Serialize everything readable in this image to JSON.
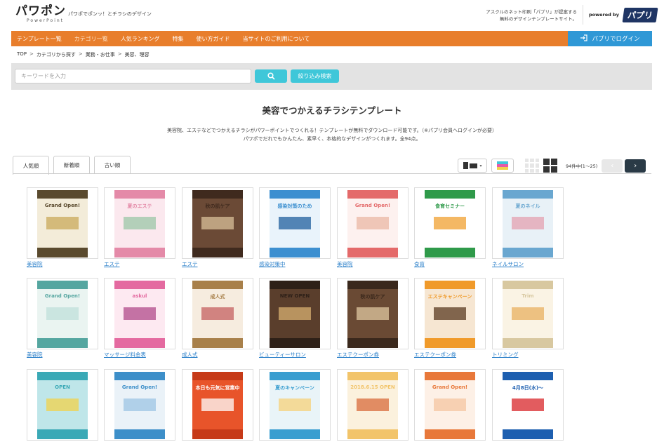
{
  "header": {
    "logo": "パワポン",
    "logo_sub": "PowerPoint",
    "tagline": "パワポでポンッ！とチラシのデザイン",
    "promo_line1": "アスクルのネット印刷「パプリ」が提案する",
    "promo_line2": "無料のデザインテンプレートサイト。",
    "powered_label": "powered by",
    "powered_brand": "パプリ"
  },
  "nav": {
    "items": [
      "テンプレート一覧",
      "カテゴリ一覧",
      "人気ランキング",
      "特集",
      "使い方ガイド",
      "当サイトのご利用について"
    ],
    "login_label": "パプリでログイン"
  },
  "breadcrumb": [
    "TOP",
    "カテゴリから探す",
    "業務・お仕事",
    "美容、理容"
  ],
  "search": {
    "placeholder": "キーワードを入力",
    "filter_label": "絞り込み検索"
  },
  "page": {
    "title": "美容でつかえるチラシテンプレート",
    "desc_line1": "美容院、エステなどでつかえるチラシがパワーポイントでつくれる！テンプレートが無料でダウンロード可能です。（※パプリ会員へログインが必要）",
    "desc_line2": "パワポでだれでもかんたん、素早く、本格的なデザインがつくれます。全94点。"
  },
  "tabs": [
    "人気順",
    "新着順",
    "古い順"
  ],
  "results": {
    "count_text": "94件中(1〜25)"
  },
  "colors": {
    "nav_orange": "#e87e2c",
    "login_blue": "#2f98d6",
    "search_cyan": "#3fc7d9",
    "link_blue": "#2a7fc9"
  },
  "cards": [
    {
      "category": "美容院",
      "title": "Grand Open!",
      "bg": "#f3ecd9",
      "band": "#5a4a2e",
      "accent": "#c9a95a"
    },
    {
      "category": "エステ",
      "title": "夏のエステ",
      "bg": "#fbe8ee",
      "band": "#e48aa8",
      "accent": "#9bc7a7"
    },
    {
      "category": "エステ",
      "title": "秋の肌ケア",
      "bg": "#6b4a36",
      "band": "#3f2a1e",
      "accent": "#d8c09a"
    },
    {
      "category": "感染対策中",
      "title": "感染対策のため",
      "bg": "#e9f3fb",
      "band": "#3c8fd0",
      "accent": "#1f5f9e"
    },
    {
      "category": "美容院",
      "title": "Grand Open!",
      "bg": "#fdf1ef",
      "band": "#e46a6a",
      "accent": "#e9b7a4"
    },
    {
      "category": "食育",
      "title": "食育セミナー",
      "bg": "#ffffff",
      "band": "#2f9a4a",
      "accent": "#f0a030"
    },
    {
      "category": "ネイルサロン",
      "title": "夏のネイル",
      "bg": "#e8f1f7",
      "band": "#6aa7d0",
      "accent": "#e4a0b0"
    },
    {
      "category": "美容院",
      "title": "Grand Open!",
      "bg": "#eaf4f1",
      "band": "#55a6a0",
      "accent": "#bfe0da"
    },
    {
      "category": "マッサージ料金表",
      "title": "askul",
      "bg": "#fde9f1",
      "band": "#e46aa0",
      "accent": "#b04a8a"
    },
    {
      "category": "成人式",
      "title": "成人式",
      "bg": "#f6ecdf",
      "band": "#a8804a",
      "accent": "#c46060"
    },
    {
      "category": "ビューティーサロン",
      "title": "NEW OPEN",
      "bg": "#5a3e2c",
      "band": "#2e2018",
      "accent": "#d8b070"
    },
    {
      "category": "エステクーポン券",
      "title": "秋の肌ケア",
      "bg": "#6a4a34",
      "band": "#3a281c",
      "accent": "#e0c8a0"
    },
    {
      "category": "エステクーポン券",
      "title": "エステキャンペーン",
      "bg": "#f6e6d2",
      "band": "#f09a2a",
      "accent": "#5a3a20"
    },
    {
      "category": "トリミング",
      "title": "Trim",
      "bg": "#faf3e4",
      "band": "#d8c8a0",
      "accent": "#e8b060"
    },
    {
      "category": "",
      "title": "OPEN",
      "bg": "#bfe6e9",
      "band": "#3aa9b6",
      "accent": "#f2d24a"
    },
    {
      "category": "",
      "title": "Grand Open!",
      "bg": "#eaf2f8",
      "band": "#3d8fc9",
      "accent": "#9cc4e4"
    },
    {
      "category": "",
      "title": "本日も元気に営業中",
      "bg": "#e8542a",
      "band": "#c63a18",
      "accent": "#ffffff"
    },
    {
      "category": "",
      "title": "夏のキャンペーン",
      "bg": "#e9f4f8",
      "band": "#3a9ed0",
      "accent": "#f6d27a"
    },
    {
      "category": "",
      "title": "2018.6.15 OPEN",
      "bg": "#fbf1dd",
      "band": "#f2c46a",
      "accent": "#d86a3a"
    },
    {
      "category": "",
      "title": "Grand Open!",
      "bg": "#fdf0e6",
      "band": "#e8783a",
      "accent": "#f4c6a0"
    },
    {
      "category": "",
      "title": "4月8日(水)〜",
      "bg": "#ffffff",
      "band": "#1d5fb0",
      "accent": "#d8252a"
    }
  ]
}
